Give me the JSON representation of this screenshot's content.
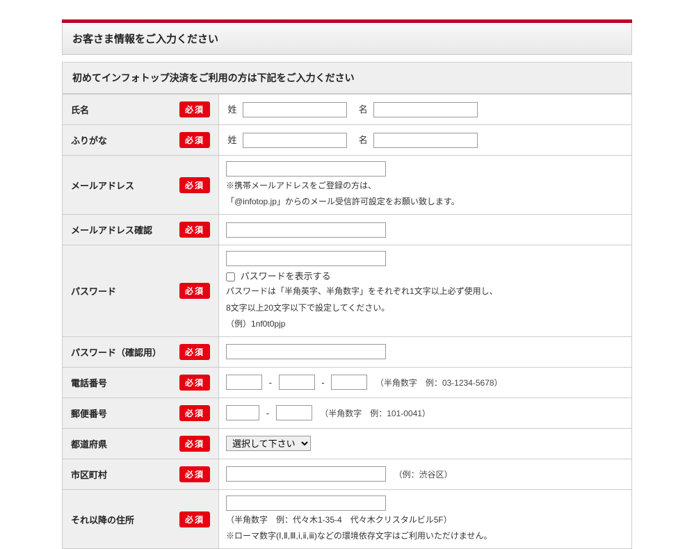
{
  "header": {
    "title": "お客さま情報をご入力ください",
    "section_title": "初めてインフォトップ決済をご利用の方は下記をご入力ください"
  },
  "badge": "必須",
  "fields": {
    "name": {
      "label": "氏名",
      "lastname_prefix": "姓",
      "firstname_prefix": "名"
    },
    "furigana": {
      "label": "ふりがな",
      "lastname_prefix": "姓",
      "firstname_prefix": "名"
    },
    "email": {
      "label": "メールアドレス",
      "note1": "※携帯メールアドレスをご登録の方は、",
      "note2": "「@infotop.jp」からのメール受信許可設定をお願い致します。"
    },
    "email_confirm": {
      "label": "メールアドレス確認"
    },
    "password": {
      "label": "パスワード",
      "show_label": "パスワードを表示する",
      "note1": "パスワードは「半角英字、半角数字」をそれぞれ1文字以上必ず使用し、",
      "note2": "8文字以上20文字以下で設定してください。",
      "note3": "（例）1nf0t0pjp"
    },
    "password_confirm": {
      "label": "パスワード（確認用）"
    },
    "phone": {
      "label": "電話番号",
      "hint": "（半角数字　例：03-1234-5678）",
      "sep": "-"
    },
    "postal": {
      "label": "郵便番号",
      "hint": "（半角数字　例：101-0041）",
      "sep": "-"
    },
    "pref": {
      "label": "都道府県",
      "placeholder": "選択して下さい"
    },
    "city": {
      "label": "市区町村",
      "hint": "（例：渋谷区）"
    },
    "address": {
      "label": "それ以降の住所",
      "note1": "（半角数字　例：代々木1-35-4　代々木クリスタルビル5F）",
      "note2": "※ローマ数字(Ⅰ,Ⅱ,Ⅲ,ⅰ,ⅱ,ⅲ)などの環境依存文字はご利用いただけません。"
    }
  }
}
